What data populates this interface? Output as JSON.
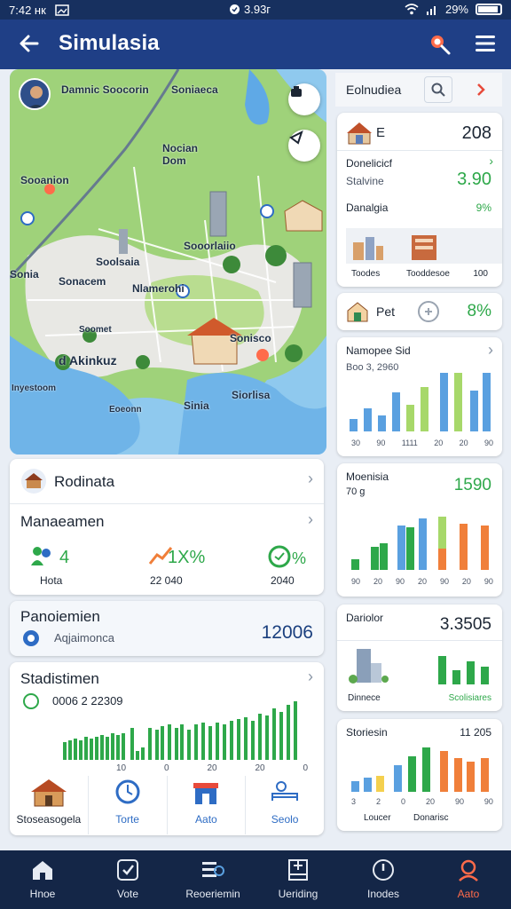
{
  "status_bar": {
    "left_text": "7:42 нк",
    "center_text": "3.93г",
    "battery_text": "29%"
  },
  "app_bar": {
    "title": "Simulasia"
  },
  "map": {
    "labels": [
      "Damnic Soocorin",
      "Soniaeca",
      "Nocian Dom",
      "Sooanion",
      "Sooorlaiio",
      "Soolsaia",
      "Sonia",
      "Sonacem",
      "Nlamerohi",
      "d Akinkuz",
      "Sonisco",
      "Inyestoom",
      "Siorlisa",
      "Sinia",
      "Eoeonn",
      "Soomet"
    ]
  },
  "right_panel": {
    "header_title": "Eolnudiea",
    "top_card": {
      "title": "E",
      "title_value": "208",
      "row1_label": "Donelicicf",
      "row1_value": "3.90",
      "row2_label": "Stalvine",
      "row3_label": "Danalgia",
      "row3_value": "9%",
      "thumb_label_1": "Toodes",
      "thumb_label_2": "Tooddesoe",
      "thumb_value": "100"
    },
    "pct_card": {
      "label": "Pet",
      "value": "8%"
    },
    "bar_card_1": {
      "title": "Namopee Sid",
      "subtitle": "Boo 3, 2960",
      "x_labels": [
        "30",
        "90",
        "1111",
        "20",
        "20",
        "90"
      ]
    },
    "bar_card_2": {
      "title": "Moenisia",
      "subtitle": "70 g",
      "value": "1590",
      "x_labels": [
        "90",
        "20",
        "90",
        "20",
        "90",
        "20",
        "90"
      ]
    },
    "value_card": {
      "title": "Dariolor",
      "value": "3.3505",
      "label_left": "Dinnece",
      "label_right": "Scolisiares"
    },
    "bar_card_3": {
      "title": "Storiesin",
      "value": "11 205",
      "x_labels": [
        "3",
        "2",
        "0",
        "20",
        "90",
        "90"
      ],
      "label_left": "Loucer",
      "label_right": "Donarisc"
    }
  },
  "left_panel": {
    "card1": {
      "row1_title": "Rodinata",
      "row2_title": "Manaeamen",
      "stats": [
        {
          "value": "4",
          "label": "Hota"
        },
        {
          "value": "1X%",
          "label": "22 040"
        },
        {
          "value": "%",
          "label": "2040"
        }
      ]
    },
    "card2": {
      "title": "Panoiemien",
      "subtitle": "Aqjaimonca",
      "value": "12006"
    },
    "card3": {
      "title": "Stadistimen",
      "subtitle": "0006 2 22309",
      "x_labels": [
        "10",
        "0",
        "20",
        "20",
        "0"
      ],
      "shortcuts": [
        "Stoseasogela",
        "Torte",
        "Aato",
        "Seolo"
      ]
    }
  },
  "bottom_nav": {
    "items": [
      "Hnoe",
      "Vote",
      "Reoeriemin",
      "Ueriding",
      "Inodes",
      "Aato"
    ]
  },
  "colors": {
    "primary": "#1f3f86",
    "status": "#17305f",
    "nav": "#142647",
    "green": "#2ea84a",
    "blue_bar": "#5aa0e0",
    "orange_bar": "#f07f3a",
    "accent": "#ff6b4a"
  },
  "icons": [
    "back-arrow-icon",
    "search-icon",
    "menu-icon",
    "layers-icon",
    "compass-icon",
    "chevron-right-icon",
    "home-icon",
    "vote-icon",
    "reference-icon",
    "building-icon",
    "clock-icon",
    "user-search-icon"
  ]
}
